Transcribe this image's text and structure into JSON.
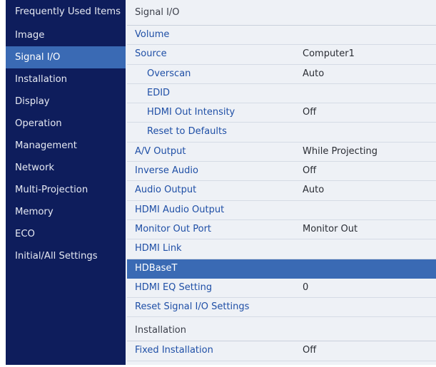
{
  "sidebar": {
    "items": [
      {
        "label": "Frequently Used Items"
      },
      {
        "label": "Image"
      },
      {
        "label": "Signal I/O"
      },
      {
        "label": "Installation"
      },
      {
        "label": "Display"
      },
      {
        "label": "Operation"
      },
      {
        "label": "Management"
      },
      {
        "label": "Network"
      },
      {
        "label": "Multi-Projection"
      },
      {
        "label": "Memory"
      },
      {
        "label": "ECO"
      },
      {
        "label": "Initial/All Settings"
      }
    ],
    "active": "Signal I/O"
  },
  "main": {
    "section_title": "Signal I/O",
    "rows": [
      {
        "label": "Volume",
        "value": ""
      },
      {
        "label": "Source",
        "value": "Computer1"
      },
      {
        "label": "Overscan",
        "value": "Auto"
      },
      {
        "label": "EDID",
        "value": ""
      },
      {
        "label": "HDMI Out Intensity",
        "value": "Off"
      },
      {
        "label": "Reset to Defaults",
        "value": ""
      },
      {
        "label": "A/V Output",
        "value": "While Projecting"
      },
      {
        "label": "Inverse Audio",
        "value": "Off"
      },
      {
        "label": "Audio Output",
        "value": "Auto"
      },
      {
        "label": "HDMI Audio Output",
        "value": ""
      },
      {
        "label": "Monitor Out Port",
        "value": "Monitor Out"
      },
      {
        "label": "HDMI Link",
        "value": ""
      },
      {
        "label": "HDBaseT",
        "value": ""
      },
      {
        "label": "HDMI EQ Setting",
        "value": "0"
      },
      {
        "label": "Reset Signal I/O Settings",
        "value": ""
      }
    ],
    "selected": "HDBaseT",
    "next_section": {
      "title": "Installation",
      "rows": [
        {
          "label": "Fixed Installation",
          "value": "Off"
        }
      ]
    }
  },
  "colors": {
    "sidebar_bg": "#0e1d5c",
    "highlight": "#3a6ab4",
    "label_blue": "#1f4fa6",
    "panel_bg": "#eef1f6"
  }
}
